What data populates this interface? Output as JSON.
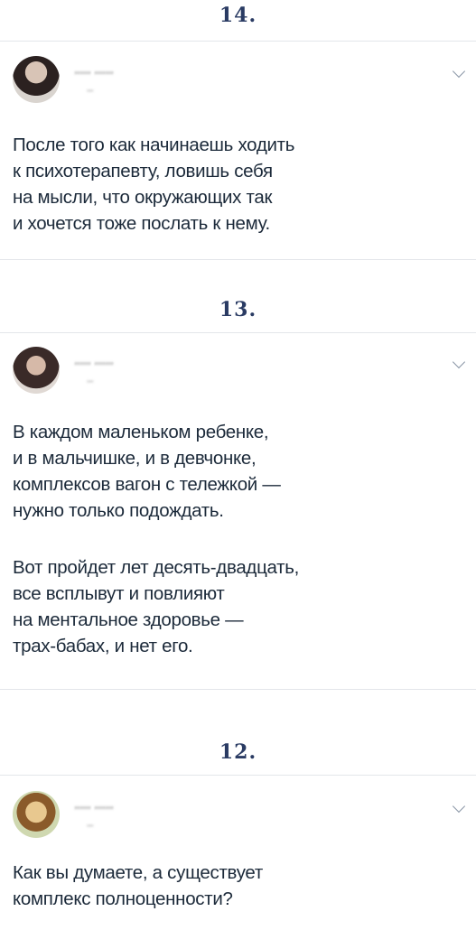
{
  "posts": [
    {
      "number": "14.",
      "name": "’’’’’’ ’’’’’’’",
      "handle": "’’’’",
      "avatar_icon": "avatar-woman-dark-hair",
      "paragraphs": [
        "После того как начинаешь ходить\nк психотерапевту, ловишь себя\nна мысли, что окружающих так\nи хочется тоже послать к нему."
      ]
    },
    {
      "number": "13.",
      "name": "’’’’’’ ’’’’’’’",
      "handle": "’’’’",
      "avatar_icon": "avatar-woman-dark-hair",
      "paragraphs": [
        "В каждом маленьком ребенке,\nи в мальчишке, и в девчонке,\nкомплексов вагон с тележкой —\nнужно только подождать.",
        "Вот пройдет лет десять-двадцать,\nвсе всплывут и повлияют\nна ментальное здоровье —\nтрах-бабах, и нет его."
      ]
    },
    {
      "number": "12.",
      "name": "’’’’’’ ’’’’’’’",
      "handle": "’’’’",
      "avatar_icon": "avatar-person-glasses",
      "paragraphs": [
        "Как вы думаете, а существует\nкомплекс полноценности?"
      ]
    }
  ],
  "colors": {
    "number": "#2a3b63",
    "text": "#1c2a3a",
    "divider": "#e3e6ea",
    "chevron": "#8a96a6"
  }
}
